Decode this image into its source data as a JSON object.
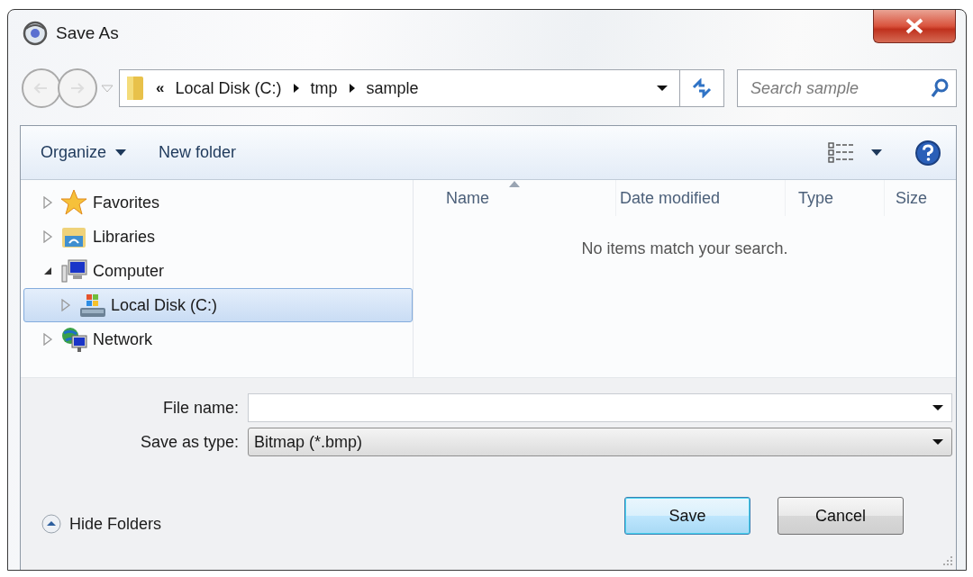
{
  "window": {
    "title": "Save As"
  },
  "address_bar": {
    "overflow": "«",
    "crumbs": [
      "Local Disk (C:)",
      "tmp",
      "sample"
    ]
  },
  "search": {
    "placeholder": "Search sample"
  },
  "toolbar": {
    "organize": "Organize",
    "new_folder": "New folder"
  },
  "nav_tree": [
    {
      "label": "Favorites",
      "kind": "star",
      "expanded": false,
      "selected": false
    },
    {
      "label": "Libraries",
      "kind": "libraries",
      "expanded": false,
      "selected": false
    },
    {
      "label": "Computer",
      "kind": "computer",
      "expanded": true,
      "selected": false,
      "children": [
        {
          "label": "Local Disk (C:)",
          "kind": "disk",
          "expanded": false,
          "selected": true
        }
      ]
    },
    {
      "label": "Network",
      "kind": "network",
      "expanded": false,
      "selected": false
    }
  ],
  "columns": [
    {
      "label": "Name",
      "sorted": true
    },
    {
      "label": "Date modified",
      "sorted": false
    },
    {
      "label": "Type",
      "sorted": false
    },
    {
      "label": "Size",
      "sorted": false
    }
  ],
  "empty_message": "No items match your search.",
  "file_name": {
    "label": "File name:"
  },
  "save_as_type": {
    "label": "Save as type:",
    "value": "Bitmap (*.bmp)"
  },
  "hide_folders": "Hide Folders",
  "buttons": [
    {
      "label": "Save",
      "default": true
    },
    {
      "label": "Cancel",
      "default": false
    }
  ]
}
